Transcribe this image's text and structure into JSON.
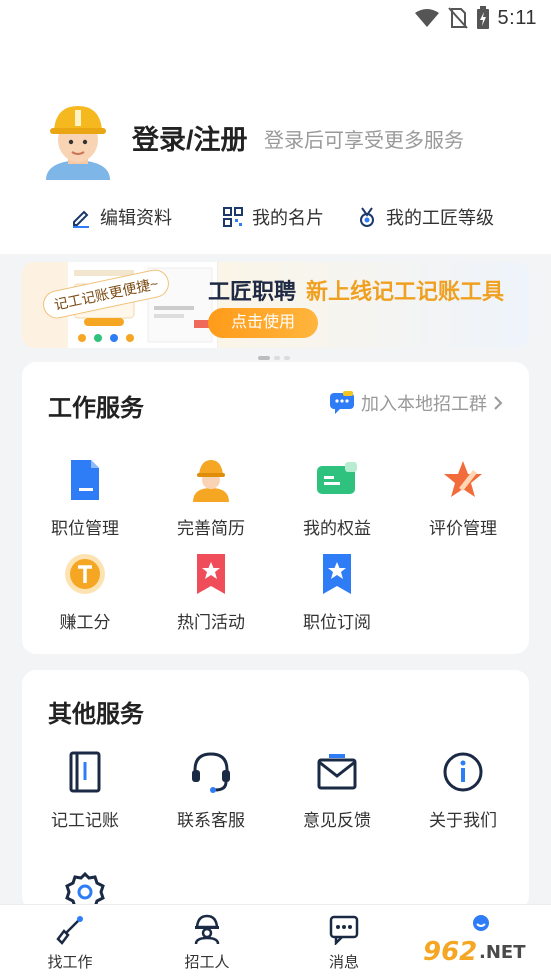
{
  "status_bar": {
    "time": "5:11"
  },
  "profile": {
    "login_title": "登录/注册",
    "login_subtitle": "登录后可享受更多服务"
  },
  "quick_actions": [
    {
      "label": "编辑资料",
      "icon": "pencil-icon"
    },
    {
      "label": "我的名片",
      "icon": "qrcode-icon"
    },
    {
      "label": "我的工匠等级",
      "icon": "medal-icon"
    }
  ],
  "banner": {
    "tag": "记工记账更便捷~",
    "title": "工匠职聘",
    "title_highlight": "新上线记工记账工具",
    "button": "点击使用"
  },
  "work_services": {
    "title": "工作服务",
    "join_link": "加入本地招工群",
    "items": [
      {
        "label": "职位管理",
        "icon": "document-icon",
        "color": "#2e7cf6"
      },
      {
        "label": "完善简历",
        "icon": "worker-icon",
        "color": "#f5a623"
      },
      {
        "label": "我的权益",
        "icon": "card-icon",
        "color": "#2ec27e"
      },
      {
        "label": "评价管理",
        "icon": "star-pen-icon",
        "color": "#f26b3a"
      },
      {
        "label": "赚工分",
        "icon": "coin-icon",
        "color": "#f5a623"
      },
      {
        "label": "热门活动",
        "icon": "bookmark-star-icon",
        "color": "#f04d5a"
      },
      {
        "label": "职位订阅",
        "icon": "bookmark-star-icon",
        "color": "#2e7cf6"
      }
    ]
  },
  "other_services": {
    "title": "其他服务",
    "items": [
      {
        "label": "记工记账",
        "icon": "notebook-icon"
      },
      {
        "label": "联系客服",
        "icon": "headset-icon"
      },
      {
        "label": "意见反馈",
        "icon": "mail-icon"
      },
      {
        "label": "关于我们",
        "icon": "info-icon"
      },
      {
        "label": "",
        "icon": "settings-icon"
      }
    ]
  },
  "bottom_nav": [
    {
      "label": "找工作",
      "icon": "shovel-icon"
    },
    {
      "label": "招工人",
      "icon": "worker-outline-icon"
    },
    {
      "label": "消息",
      "icon": "chat-icon"
    },
    {
      "label": "",
      "icon": "profile-icon"
    }
  ],
  "watermark": "962.NET"
}
